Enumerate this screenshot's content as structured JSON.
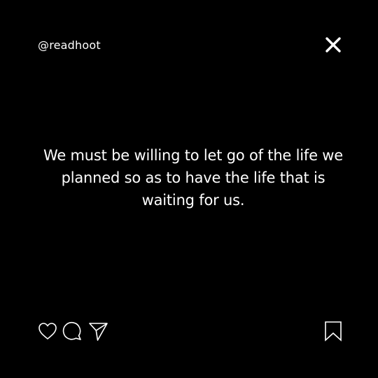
{
  "post": {
    "handle": "@readhoot",
    "quote": "We must be willing to let go of the life we planned so as to have the life that is waiting for us."
  },
  "icons": {
    "close": "close-icon",
    "like": "heart-icon",
    "comment": "comment-icon",
    "share": "paper-plane-icon",
    "save": "bookmark-icon"
  },
  "colors": {
    "background": "#000000",
    "foreground": "#ffffff"
  }
}
